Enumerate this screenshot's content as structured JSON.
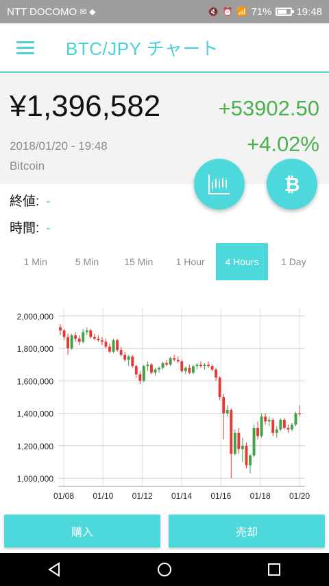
{
  "status_bar": {
    "carrier": "NTT DOCOMO",
    "battery": "71%",
    "battery_level": 0.71,
    "time": "19:48"
  },
  "header": {
    "title": "BTC/JPY チャート"
  },
  "ticker": {
    "price": "¥1,396,582",
    "change": "+53902.50",
    "change_percent": "+4.02%",
    "datetime": "2018/01/20 - 19:48",
    "coin_name": "Bitcoin",
    "change_color": "#4caf50"
  },
  "info": {
    "close_label": "終値:",
    "close_value": "-",
    "time_label": "時間:",
    "time_value": "-"
  },
  "tabs": [
    {
      "label": "1 Min",
      "active": false
    },
    {
      "label": "5 Min",
      "active": false
    },
    {
      "label": "15 Min",
      "active": false
    },
    {
      "label": "1 Hour",
      "active": false
    },
    {
      "label": "4 Hours",
      "active": true
    },
    {
      "label": "1 Day",
      "active": false
    }
  ],
  "actions": {
    "buy_label": "購入",
    "sell_label": "売却"
  },
  "colors": {
    "accent": "#4dd9db",
    "up": "#43a047",
    "down": "#e53935"
  },
  "chart_data": {
    "type": "candlestick",
    "y_tick_labels": [
      "2,000,000",
      "1,800,000",
      "1,600,000",
      "1,400,000",
      "1,200,000",
      "1,000,000"
    ],
    "y_ticks": [
      2000000,
      1800000,
      1600000,
      1400000,
      1200000,
      1000000
    ],
    "x_tick_labels": [
      "01/08",
      "01/10",
      "01/12",
      "01/14",
      "01/16",
      "01/18",
      "01/20"
    ],
    "ylim": [
      950000,
      2050000
    ],
    "grid": true,
    "candles": [
      [
        1930000,
        1950000,
        1880000,
        1910000
      ],
      [
        1910000,
        1920000,
        1850000,
        1870000
      ],
      [
        1870000,
        1890000,
        1760000,
        1800000
      ],
      [
        1800000,
        1890000,
        1790000,
        1880000
      ],
      [
        1880000,
        1900000,
        1840000,
        1860000
      ],
      [
        1860000,
        1880000,
        1820000,
        1840000
      ],
      [
        1840000,
        1920000,
        1830000,
        1900000
      ],
      [
        1900000,
        1930000,
        1880000,
        1910000
      ],
      [
        1910000,
        1920000,
        1860000,
        1870000
      ],
      [
        1870000,
        1890000,
        1850000,
        1860000
      ],
      [
        1860000,
        1880000,
        1840000,
        1850000
      ],
      [
        1850000,
        1870000,
        1820000,
        1840000
      ],
      [
        1840000,
        1860000,
        1800000,
        1810000
      ],
      [
        1810000,
        1830000,
        1770000,
        1780000
      ],
      [
        1780000,
        1860000,
        1770000,
        1850000
      ],
      [
        1850000,
        1860000,
        1780000,
        1790000
      ],
      [
        1790000,
        1810000,
        1750000,
        1760000
      ],
      [
        1760000,
        1780000,
        1720000,
        1730000
      ],
      [
        1730000,
        1760000,
        1690000,
        1750000
      ],
      [
        1750000,
        1760000,
        1680000,
        1690000
      ],
      [
        1690000,
        1700000,
        1620000,
        1640000
      ],
      [
        1640000,
        1660000,
        1580000,
        1600000
      ],
      [
        1600000,
        1700000,
        1590000,
        1690000
      ],
      [
        1690000,
        1720000,
        1660000,
        1700000
      ],
      [
        1700000,
        1710000,
        1640000,
        1650000
      ],
      [
        1650000,
        1680000,
        1630000,
        1670000
      ],
      [
        1670000,
        1690000,
        1650000,
        1680000
      ],
      [
        1680000,
        1720000,
        1670000,
        1710000
      ],
      [
        1710000,
        1730000,
        1690000,
        1700000
      ],
      [
        1700000,
        1750000,
        1690000,
        1740000
      ],
      [
        1740000,
        1760000,
        1720000,
        1730000
      ],
      [
        1730000,
        1750000,
        1710000,
        1720000
      ],
      [
        1720000,
        1730000,
        1650000,
        1660000
      ],
      [
        1660000,
        1690000,
        1640000,
        1680000
      ],
      [
        1680000,
        1700000,
        1640000,
        1650000
      ],
      [
        1650000,
        1700000,
        1640000,
        1690000
      ],
      [
        1690000,
        1710000,
        1670000,
        1700000
      ],
      [
        1700000,
        1720000,
        1680000,
        1690000
      ],
      [
        1690000,
        1710000,
        1670000,
        1700000
      ],
      [
        1700000,
        1720000,
        1680000,
        1690000
      ],
      [
        1690000,
        1700000,
        1660000,
        1670000
      ],
      [
        1670000,
        1680000,
        1600000,
        1620000
      ],
      [
        1620000,
        1630000,
        1480000,
        1500000
      ],
      [
        1500000,
        1520000,
        1240000,
        1400000
      ],
      [
        1400000,
        1450000,
        1380000,
        1420000
      ],
      [
        1420000,
        1430000,
        1000000,
        1150000
      ],
      [
        1150000,
        1300000,
        1140000,
        1280000
      ],
      [
        1280000,
        1310000,
        1150000,
        1180000
      ],
      [
        1180000,
        1250000,
        1100000,
        1200000
      ],
      [
        1200000,
        1220000,
        1060000,
        1080000
      ],
      [
        1080000,
        1150000,
        1030000,
        1140000
      ],
      [
        1140000,
        1330000,
        1130000,
        1310000
      ],
      [
        1310000,
        1350000,
        1240000,
        1260000
      ],
      [
        1260000,
        1400000,
        1250000,
        1380000
      ],
      [
        1380000,
        1400000,
        1330000,
        1350000
      ],
      [
        1350000,
        1380000,
        1320000,
        1360000
      ],
      [
        1360000,
        1370000,
        1260000,
        1280000
      ],
      [
        1280000,
        1320000,
        1250000,
        1300000
      ],
      [
        1300000,
        1370000,
        1290000,
        1360000
      ],
      [
        1360000,
        1370000,
        1300000,
        1310000
      ],
      [
        1310000,
        1330000,
        1280000,
        1300000
      ],
      [
        1300000,
        1340000,
        1290000,
        1330000
      ],
      [
        1330000,
        1410000,
        1320000,
        1400000
      ],
      [
        1400000,
        1450000,
        1380000,
        1395000
      ]
    ]
  }
}
